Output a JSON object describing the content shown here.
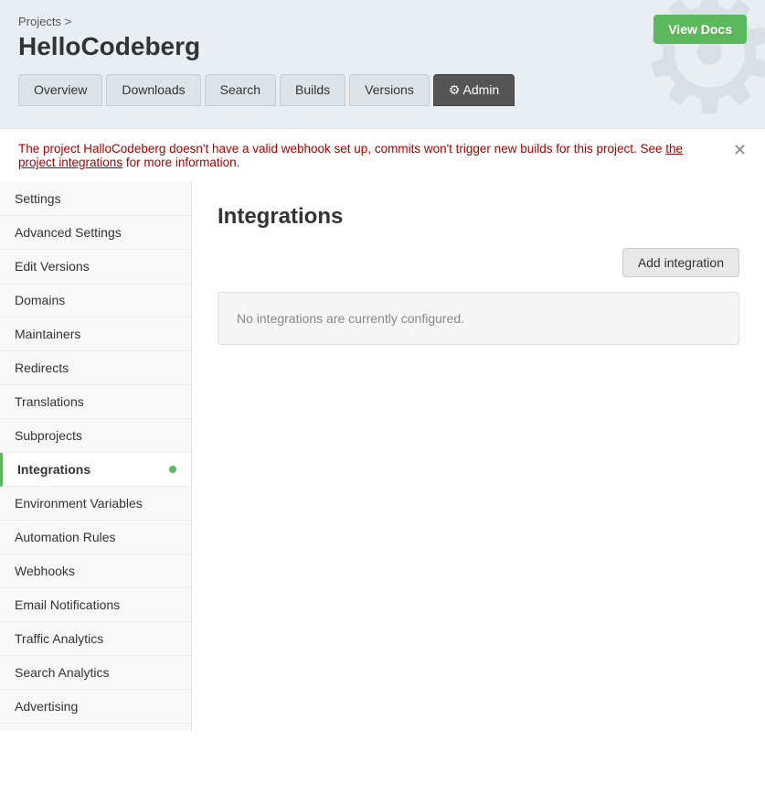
{
  "breadcrumb": {
    "projects_label": "Projects",
    "separator": ">"
  },
  "header": {
    "project_title": "HelloCodeberg",
    "view_docs_label": "View Docs"
  },
  "nav": {
    "tabs": [
      {
        "id": "overview",
        "label": "Overview",
        "active": false
      },
      {
        "id": "downloads",
        "label": "Downloads",
        "active": false
      },
      {
        "id": "search",
        "label": "Search",
        "active": false
      },
      {
        "id": "builds",
        "label": "Builds",
        "active": false
      },
      {
        "id": "versions",
        "label": "Versions",
        "active": false
      },
      {
        "id": "admin",
        "label": "Admin",
        "active": true,
        "admin": true
      }
    ]
  },
  "alert": {
    "message_prefix": "The project HalloCodeberg doesn't have a valid webhook set up, commits won't trigger new builds for this project. See",
    "link_text": "the project integrations",
    "message_suffix": "for more information."
  },
  "sidebar": {
    "items": [
      {
        "id": "settings",
        "label": "Settings",
        "active": false
      },
      {
        "id": "advanced-settings",
        "label": "Advanced Settings",
        "active": false
      },
      {
        "id": "edit-versions",
        "label": "Edit Versions",
        "active": false
      },
      {
        "id": "domains",
        "label": "Domains",
        "active": false
      },
      {
        "id": "maintainers",
        "label": "Maintainers",
        "active": false
      },
      {
        "id": "redirects",
        "label": "Redirects",
        "active": false
      },
      {
        "id": "translations",
        "label": "Translations",
        "active": false
      },
      {
        "id": "subprojects",
        "label": "Subprojects",
        "active": false
      },
      {
        "id": "integrations",
        "label": "Integrations",
        "active": true,
        "dot": true
      },
      {
        "id": "environment-variables",
        "label": "Environment Variables",
        "active": false
      },
      {
        "id": "automation-rules",
        "label": "Automation Rules",
        "active": false
      },
      {
        "id": "webhooks",
        "label": "Webhooks",
        "active": false
      },
      {
        "id": "email-notifications",
        "label": "Email Notifications",
        "active": false
      },
      {
        "id": "traffic-analytics",
        "label": "Traffic Analytics",
        "active": false
      },
      {
        "id": "search-analytics",
        "label": "Search Analytics",
        "active": false
      },
      {
        "id": "advertising",
        "label": "Advertising",
        "active": false
      }
    ]
  },
  "content": {
    "title": "Integrations",
    "add_button_label": "Add integration",
    "empty_message": "No integrations are currently configured."
  }
}
